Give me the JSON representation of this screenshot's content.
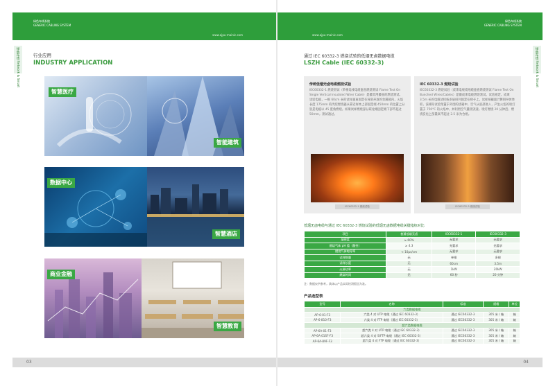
{
  "left": {
    "header": {
      "brand_line1": "绿色布线系统",
      "brand_line2": "GENERIC CABLING SYSTEM",
      "url": "www.ajpu-mainic.com"
    },
    "side_tab": "绿色布线 Network & Smart",
    "section_zh": "行业应用",
    "section_en": "INDUSTRY APPLICATION",
    "tiles": [
      "智慧医疗",
      "智能建筑",
      "数据中心",
      "智慧酒店",
      "商业金融",
      "智慧教育"
    ],
    "page_number": "03"
  },
  "right": {
    "header": {
      "brand_line1": "绿色布线系统",
      "brand_line2": "GENERIC CABLING SYSTEM",
      "url": "www.ajpu-mainic.com"
    },
    "side_tab": "绿色布线 Network & Smart",
    "title_zh": "通过 IEC 60332-3 燃烧试验的低烟无卤数据电缆",
    "title_en": "LSZH Cable (IEC 60332-3)",
    "box1": {
      "title": "传统低烟无卤电缆燃烧试验",
      "body": "IEC60332-1 燃烧测试（单根电线电缆垂直燃烧测试 Flame Test On Single Vertical Insulated Wire/ Cable）是最常用最低的燃烧测试。试验电缆，一根 60cm 长的试样垂直固定在背部开放的金属箱内，火焰长度 175mm 的丙烷燃烧器从靠近样本上部固定端 450mm 的位置上分别是电缆以 45 度角燃烧。如果试样燃烧部分碳化端固定端下部不超过 50mm，测试通过。",
      "caption": "IEC60332-1 燃烧试验"
    },
    "box2": {
      "title": "IEC 60332-3 燃烧试验",
      "body": "IEC60332-3 燃烧试验（成束电线或线缆垂直燃烧测试 Flame Test On Bunched Wires/Cables）是最成束电缆燃烧测试。试验规定，成束 3.5m 长的电缆试样按多层排列固定在梯子上，试样按截面计算铜导体体积，该梯形试验架置于外围的烧箱中，空气从底部进入，产生火焰的喷灯置于 750°C 的火焰中，并利用空气量测流速，喷灯燃烧 20 分钟后，燃烧炭化上部最高不超过 2.5 米为合格。",
      "caption": "IEC60332-3 燃烧试验"
    },
    "comparison": {
      "title": "低烟无卤电缆与通过 IEC 60332-3 燃烧试验的低烟无卤数据电缆关键指标对比",
      "headers": [
        "项目",
        "普通低烟无卤",
        "IEC60332-1",
        "IEC60332-3"
      ],
      "rows": [
        [
          "烟密度",
          "≥ 60%",
          "无要求",
          "无要求"
        ],
        [
          "燃烧气体 pH 值（酸性）",
          "≥ 4.3",
          "无要求",
          "无要求"
        ],
        [
          "燃烧气体电导率",
          "< 10μs/cm",
          "无要求",
          "无要求"
        ],
        [
          "试样数量",
          "无",
          "单根",
          "多根"
        ],
        [
          "试样长度",
          "无",
          "60cm",
          "3.5m"
        ],
        [
          "火源功率",
          "无",
          "1kW",
          "20kW"
        ],
        [
          "燃烧时间",
          "无",
          "60 秒",
          "20 分钟"
        ]
      ],
      "note": "注：数据仅供参考，具体以产品实际检测报告为准。"
    },
    "products": {
      "title": "产品选型表",
      "headers": [
        "型号",
        "名称",
        "标准",
        "规格",
        "单位"
      ],
      "groups": [
        {
          "name": "六类数据电缆",
          "rows": [
            [
              "AP-6-01-F3",
              "六类 4 对 UTP 电缆（通过 IEC 60332-3）",
              "通过 IEC60332-3",
              "305 米 / 箱",
              "箱"
            ],
            [
              "AP-6-810-F3",
              "六类 4 对 FTP 电缆（通过 IEC 60332-3）",
              "通过 IEC60332-3",
              "305 米 / 箱",
              "箱"
            ]
          ]
        },
        {
          "name": "超六类数据电缆",
          "rows": [
            [
              "AP-6A-01-F3",
              "超六类 4 对 UTP 电缆（通过 IEC 60332-3）",
              "通过 IEC60332-3",
              "305 米 / 箱",
              "箱"
            ],
            [
              "AP-6A-01SF-F3",
              "超六类 4 对 S/FTP 电缆（通过 IEC 60332-3）",
              "通过 IEC60332-3",
              "305 米 / 箱",
              "箱"
            ],
            [
              "AP-6A-89F-F3",
              "超六类 4 对 FTP 电缆（通过 IEC 60332-3）",
              "通过 IEC60332-3",
              "305 米 / 箱",
              "箱"
            ]
          ]
        }
      ]
    },
    "page_number": "04"
  },
  "colors": {
    "brand_green": "#3aa844",
    "header_green": "#2e9e3b",
    "panel_gray": "#ececec"
  }
}
